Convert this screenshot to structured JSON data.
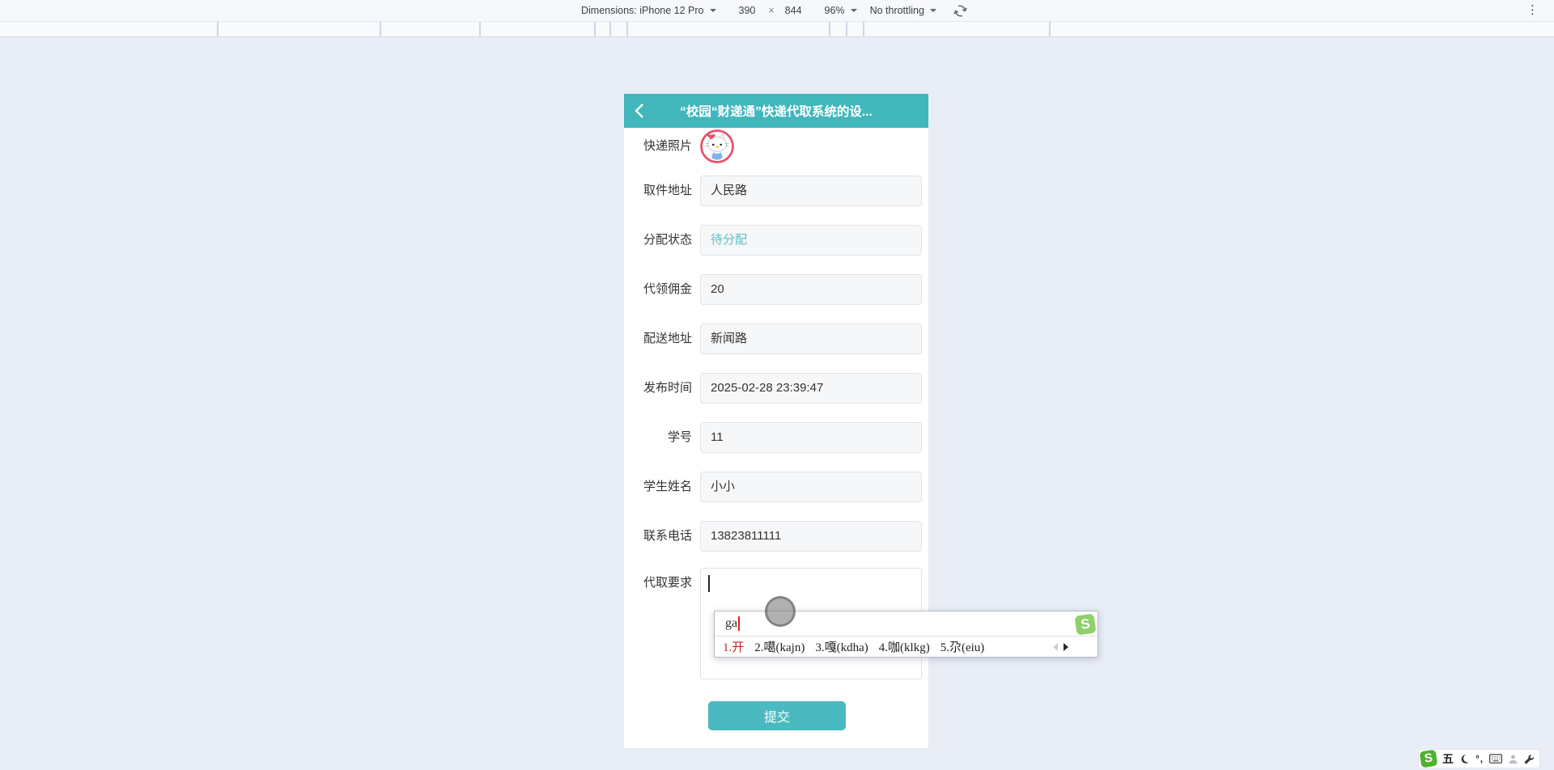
{
  "devtools_bar": {
    "dimensions_label": "Dimensions:",
    "device_name": "iPhone 12 Pro",
    "viewport_width": "390",
    "multiply_sign": "×",
    "viewport_height": "844",
    "zoom_value": "96%",
    "throttling_value": "No throttling",
    "menu_glyph": "⋮"
  },
  "page": {
    "header": {
      "title": "“校园“财递通”快递代取系统的设..."
    },
    "form": {
      "rows": [
        {
          "label": "快递照片",
          "value": ""
        },
        {
          "label": "取件地址",
          "value": "人民路"
        },
        {
          "label": "分配状态",
          "value": "待分配"
        },
        {
          "label": "代领佣金",
          "value": "20"
        },
        {
          "label": "配送地址",
          "value": "新闻路"
        },
        {
          "label": "发布时间",
          "value": "2025-02-28 23:39:47"
        },
        {
          "label": "学号",
          "value": "11"
        },
        {
          "label": "学生姓名",
          "value": "小小"
        },
        {
          "label": "联系电话",
          "value": "13823811111"
        },
        {
          "label": "代取要求",
          "value": ""
        }
      ],
      "submit_label": "提交"
    }
  },
  "ime": {
    "composition": "ga",
    "candidates": [
      {
        "index": "1.",
        "char": "开",
        "code": ""
      },
      {
        "index": "2.",
        "char": "噶",
        "code": "(kajn)"
      },
      {
        "index": "3.",
        "char": "嘎",
        "code": "(kdha)"
      },
      {
        "index": "4.",
        "char": "咖",
        "code": "(klkg)"
      },
      {
        "index": "5.",
        "char": "尕",
        "code": "(eiu)"
      }
    ],
    "logo_letter": "S"
  },
  "sogou_bar": {
    "logo_letter": "S",
    "wubi_label": "五",
    "punctuation_label": "°,"
  },
  "colors": {
    "header_teal": "#41b6bb",
    "button_teal": "#4bb9c0",
    "status_teal": "#56c0c5",
    "candidate_red": "#cc2222",
    "sogou_green": "#4db32e",
    "background": "#e9edf6"
  }
}
